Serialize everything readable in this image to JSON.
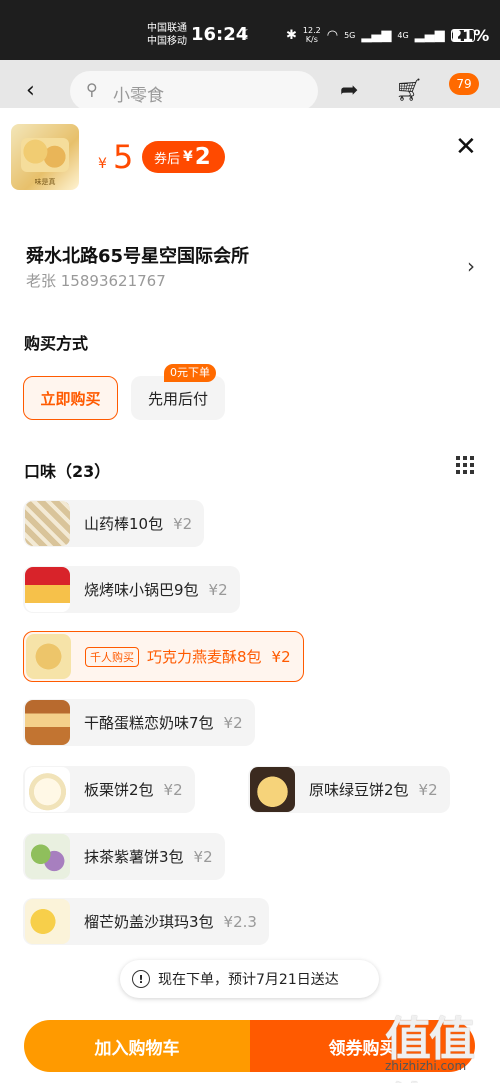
{
  "status_bar": {
    "carrier_1": "中国联通",
    "carrier_2": "中国移动",
    "time": "16:24",
    "speed_value": "12.2",
    "speed_unit": "K/s",
    "network_1": "5G",
    "network_2": "4G",
    "battery": "21%"
  },
  "header": {
    "search_placeholder": "小零食",
    "cart_badge": "79"
  },
  "product": {
    "thumb_brand": "味是真",
    "currency": "¥",
    "price": "5",
    "coupon_label": "券后",
    "coupon_currency": "¥",
    "coupon_price": "2"
  },
  "address": {
    "title": "舜水北路65号星空国际会所",
    "contact": "老张 15893621767"
  },
  "purchase": {
    "title": "购买方式",
    "options": [
      "立即购买",
      "先用后付"
    ],
    "pay_later_tag": "0元下单"
  },
  "flavors": {
    "title": "口味（23）",
    "hot_tag": "千人购买",
    "items": [
      {
        "name": "山药棒10包",
        "price": "¥2"
      },
      {
        "name": "烧烤味小锅巴9包",
        "price": "¥2"
      },
      {
        "name": "巧克力燕麦酥8包",
        "price": "¥2"
      },
      {
        "name": "干酪蛋糕恋奶味7包",
        "price": "¥2"
      },
      {
        "name": "板栗饼2包",
        "price": "¥2"
      },
      {
        "name": "原味绿豆饼2包",
        "price": "¥2"
      },
      {
        "name": "抹茶紫薯饼3包",
        "price": "¥2"
      },
      {
        "name": "榴芒奶盖沙琪玛3包",
        "price": "¥2.3"
      }
    ]
  },
  "notice": "现在下单，预计7月21日送达",
  "actions": {
    "add_to_cart": "加入购物车",
    "buy_with_coupon": "领券购买"
  },
  "watermark": {
    "logo": "值值值",
    "url": "zhizhizhi.com"
  },
  "colors": {
    "accent": "#ff5a00",
    "cart_button": "#ff9a00"
  }
}
